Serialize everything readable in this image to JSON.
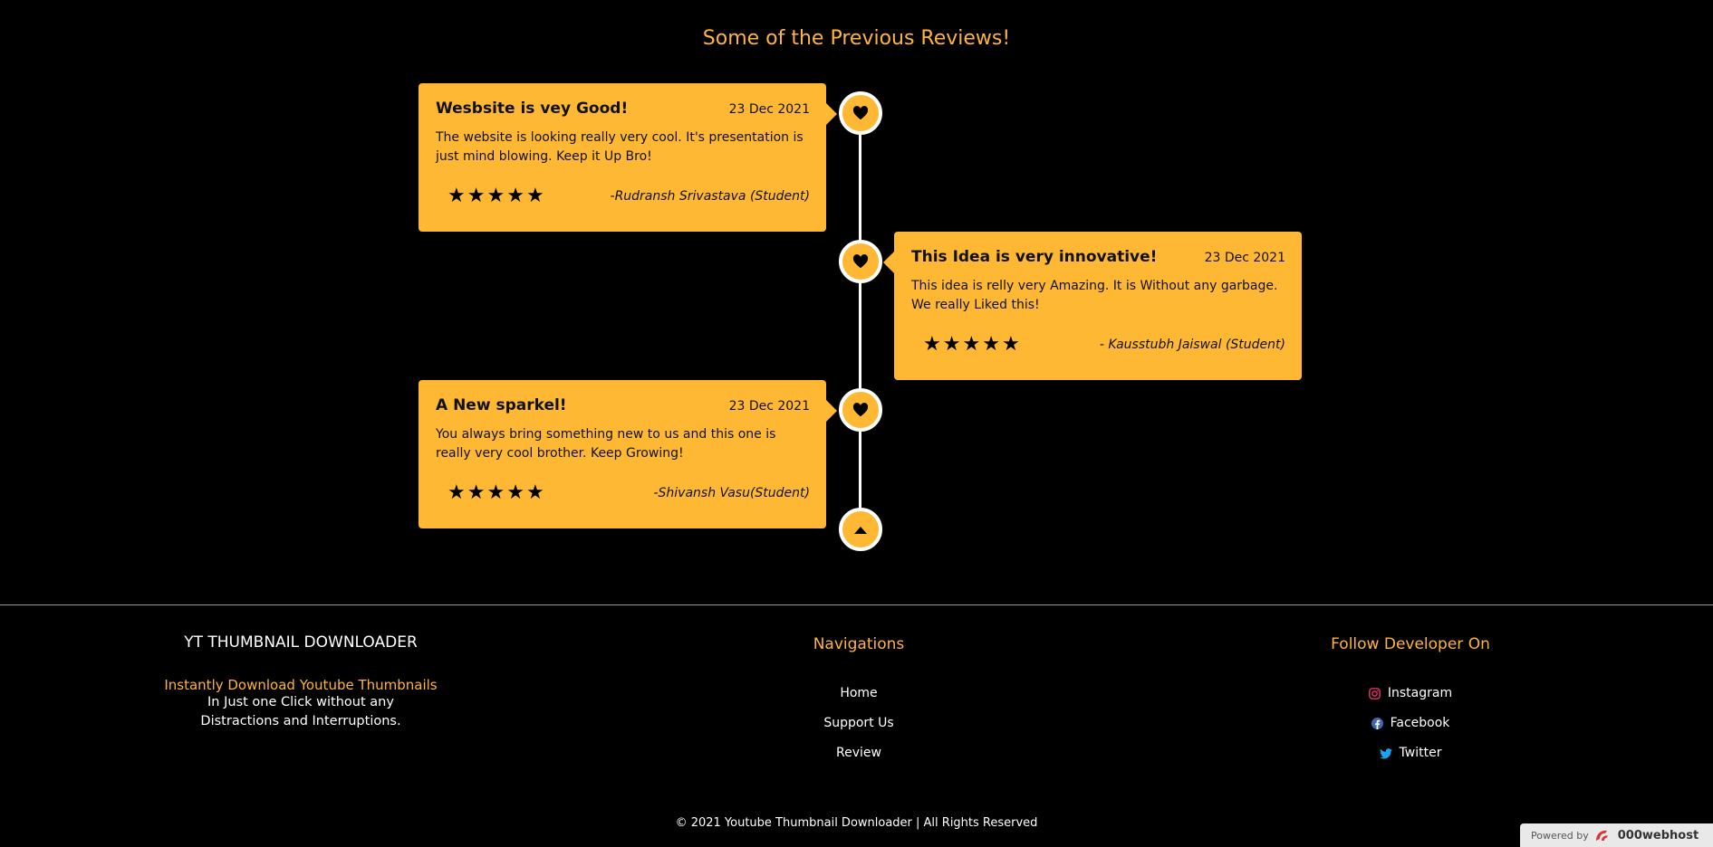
{
  "reviews": {
    "title": "Some of the Previous Reviews!",
    "items": [
      {
        "title": "Wesbsite is vey Good!",
        "date": "23 Dec 2021",
        "text": "The website is looking really very cool. It's presentation is just mind blowing. Keep it Up Bro!",
        "rating": 5,
        "author": "-Rudransh Srivastava (Student)"
      },
      {
        "title": "This Idea is very innovative!",
        "date": "23 Dec 2021",
        "text": "This idea is relly very Amazing. It is Without any garbage. We really Liked this!",
        "rating": 5,
        "author": "- Kausstubh Jaiswal (Student)"
      },
      {
        "title": "A New sparkel!",
        "date": "23 Dec 2021",
        "text": "You always bring something new to us and this one is really very cool brother. Keep Growing!",
        "rating": 5,
        "author": "-Shivansh Vasu(Student)"
      }
    ],
    "node_icon": "heart-icon",
    "top_button_icon": "caret-up-icon"
  },
  "footer": {
    "brand": "YT THUMBNAIL DOWNLOADER",
    "tagline_accent": "Instantly Download Youtube Thumbnails",
    "tagline_line1": "In Just one Click without any",
    "tagline_line2": "Distractions and Interruptions.",
    "nav_heading": "Navigations",
    "nav_links": [
      "Home",
      "Support Us",
      "Review"
    ],
    "follow_heading": "Follow Developer On",
    "social_links": [
      {
        "label": "Instagram",
        "icon": "instagram-icon",
        "color": "#e1306c"
      },
      {
        "label": "Facebook",
        "icon": "facebook-icon",
        "color": "#4267b2"
      },
      {
        "label": "Twitter",
        "icon": "twitter-icon",
        "color": "#1da1f2"
      }
    ],
    "copyright": "© 2021 Youtube Thumbnail Downloader | All Rights Reserved"
  },
  "badge": {
    "powered_by": "Powered by",
    "brand": "000webhost"
  },
  "colors": {
    "accent": "#ffb43a",
    "card": "#ffb833",
    "background": "#000000"
  }
}
